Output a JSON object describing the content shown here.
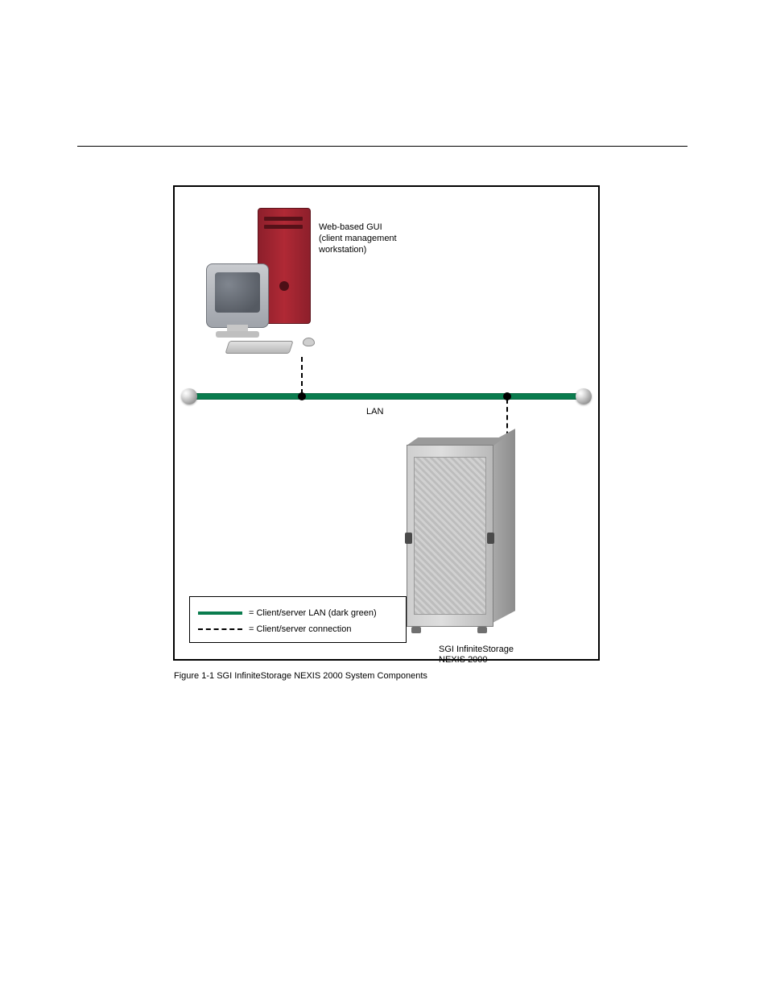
{
  "diagram": {
    "workstation_label_line1": "Web-based GUI",
    "workstation_label_line2": "(client management",
    "workstation_label_line3": "workstation)",
    "lan_label": "LAN",
    "rack_label_line1": "SGI InfiniteStorage",
    "rack_label_line2": "NEXIS 2000"
  },
  "legend": {
    "lan": "= Client/server LAN (dark green)",
    "connection": "= Client/server connection"
  },
  "figure_caption": "Figure 1-1  SGI InfiniteStorage NEXIS 2000 System Components"
}
